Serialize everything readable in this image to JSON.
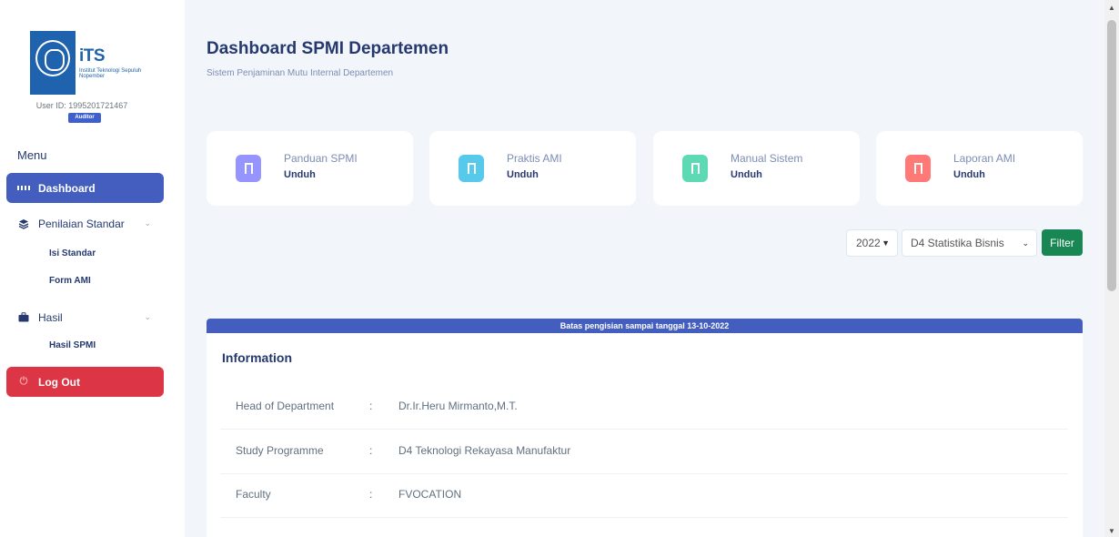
{
  "logo": {
    "text": "iTS",
    "subtitle": "Institut Teknologi Sepuluh Nopember"
  },
  "user": {
    "id_text": "User ID: 1995201721467",
    "role_badge": "Auditor"
  },
  "sidebar": {
    "menu_title": "Menu",
    "items": [
      {
        "label": "Dashboard",
        "icon": "grid-icon",
        "active": true
      },
      {
        "label": "Penilaian Standar",
        "icon": "layers-icon",
        "expandable": true
      },
      {
        "label": "Hasil",
        "icon": "briefcase-icon",
        "expandable": true
      }
    ],
    "subitems": {
      "penilaian": [
        "Isi Standar",
        "Form AMI"
      ],
      "hasil": [
        "Hasil SPMI"
      ]
    },
    "logout_label": "Log Out"
  },
  "header": {
    "title": "Dashboard SPMI Departemen",
    "subtitle": "Sistem Penjaminan Mutu Internal Departemen"
  },
  "cards": [
    {
      "title": "Panduan SPMI",
      "link": "Unduh",
      "color": "#9694ff"
    },
    {
      "title": "Praktis AMI",
      "link": "Unduh",
      "color": "#57caeb"
    },
    {
      "title": "Manual Sistem",
      "link": "Unduh",
      "color": "#5ddab4"
    },
    {
      "title": "Laporan AMI",
      "link": "Unduh",
      "color": "#ff7976"
    }
  ],
  "filters": {
    "year": "2022",
    "program": "D4 Statistika Bisnis",
    "button": "Filter"
  },
  "banner": "Batas pengisian sampai tanggal 13-10-2022",
  "info": {
    "title": "Information",
    "rows": [
      {
        "key": "Head of Department",
        "value": "Dr.Ir.Heru Mirmanto,M.T."
      },
      {
        "key": "Study Programme",
        "value": "D4 Teknologi Rekayasa Manufaktur"
      },
      {
        "key": "Faculty",
        "value": "FVOCATION"
      }
    ]
  }
}
